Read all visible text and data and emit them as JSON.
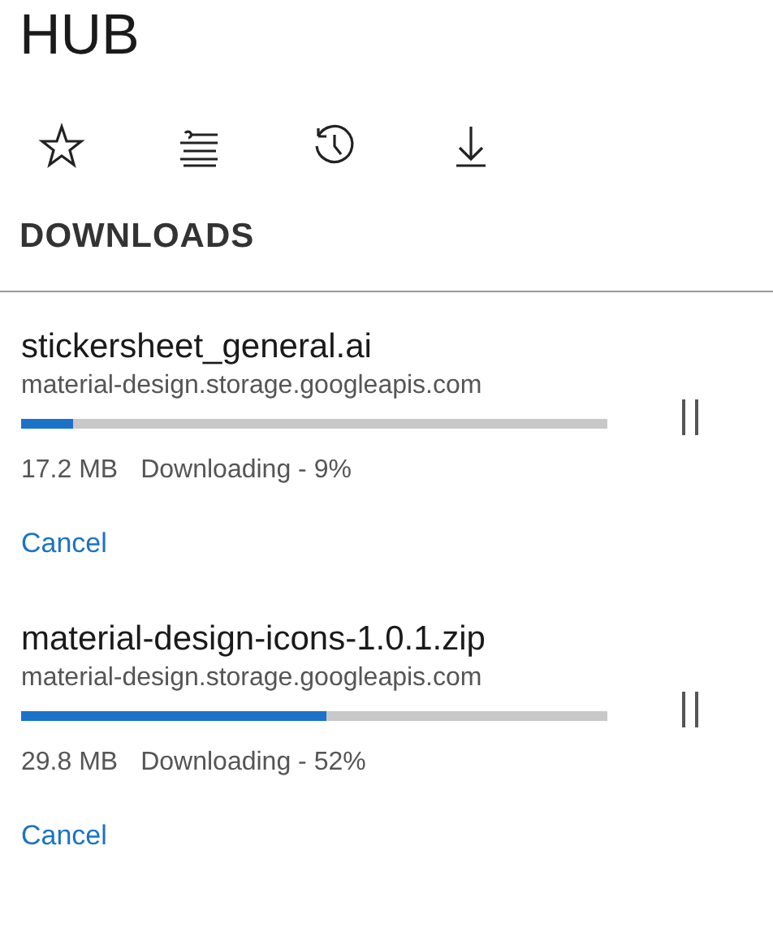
{
  "title": "HUB",
  "section": {
    "heading": "DOWNLOADS"
  },
  "downloads": [
    {
      "name": "stickersheet_general.ai",
      "source": "material-design.storage.googleapis.com",
      "level": 0.09,
      "size": "17.2 MB",
      "status": "Downloading - 9%",
      "cancel": "Cancel"
    },
    {
      "name": "material-design-icons-1.0.1.zip",
      "source": "material-design.storage.googleapis.com",
      "level": 0.52,
      "size": "29.8 MB",
      "status": "Downloading - 52%",
      "cancel": "Cancel"
    }
  ]
}
